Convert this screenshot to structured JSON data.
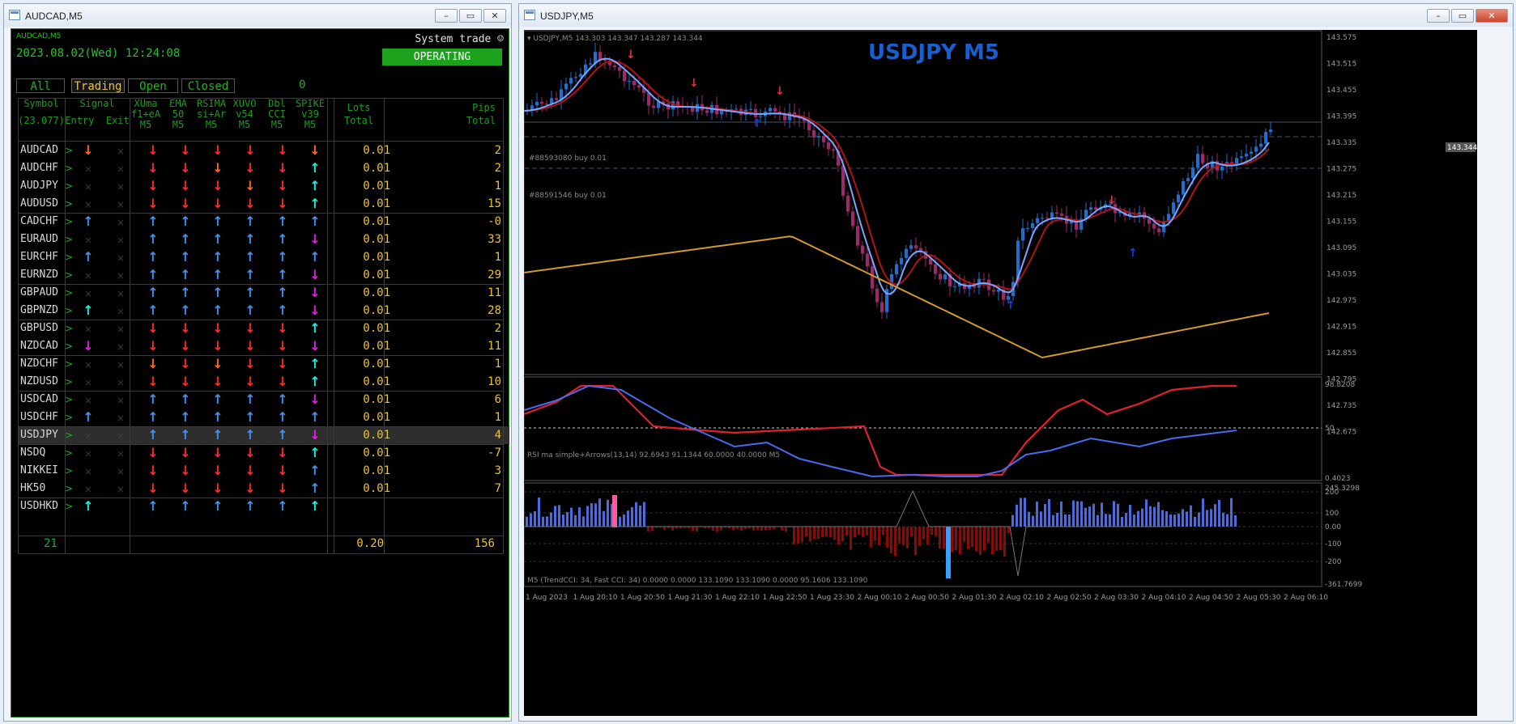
{
  "left_window": {
    "title": "AUDCAD,M5",
    "min_label": "0",
    "max_label": "1",
    "close_label": "r",
    "panel_symbol": "AUDCAD,M5",
    "datetime": "2023.08.02(Wed) 12:24:08",
    "system_trade": "System trade ☺",
    "status": "OPERATING",
    "filters": [
      "All",
      "Trading",
      "Open",
      "Closed"
    ],
    "filter_count": "0",
    "headers": {
      "symbol": [
        "Symbol",
        "(23.077)"
      ],
      "signal": [
        "Signal",
        "Entry  Exit"
      ],
      "xuma": [
        "XUma",
        "f1+eA",
        "M5"
      ],
      "ema": [
        "EMA",
        "50",
        "M5"
      ],
      "rsima": [
        "RSIMA",
        "si+Ar",
        "M5"
      ],
      "xuvo": [
        "XUVO",
        "v54",
        "M5"
      ],
      "dblcci": [
        "Dbl",
        "CCI",
        "M5"
      ],
      "spike": [
        "SPIKE",
        "v39",
        "M5"
      ],
      "lots": [
        "Lots",
        "Total"
      ],
      "pips": [
        "Pips",
        "Total"
      ]
    },
    "colors": {
      "up_blue": "#4a8fe6",
      "up_cyan": "#19f0e0",
      "down_red": "#ff2a2a",
      "down_orange": "#ff6a1a",
      "down_magenta": "#e01ee8",
      "gold": "#e8c23a",
      "green": "#1ca21c"
    },
    "rows": [
      {
        "symbol": "AUDCAD",
        "entry": "down-orange",
        "exit": "x",
        "sig": [
          "down-red",
          "down-red",
          "down-red",
          "down-red",
          "down-red",
          "down-orange"
        ],
        "lots": "0.01",
        "pips": "2"
      },
      {
        "symbol": "AUDCHF",
        "entry": "x",
        "exit": "x",
        "sig": [
          "down-red",
          "down-red",
          "down-orange",
          "down-red",
          "down-red",
          "up-cyan"
        ],
        "lots": "0.01",
        "pips": "2"
      },
      {
        "symbol": "AUDJPY",
        "entry": "x",
        "exit": "x",
        "sig": [
          "down-red",
          "down-red",
          "down-red",
          "down-orange",
          "down-red",
          "up-cyan"
        ],
        "lots": "0.01",
        "pips": "1"
      },
      {
        "symbol": "AUDUSD",
        "entry": "x",
        "exit": "x",
        "sig": [
          "down-red",
          "down-red",
          "down-red",
          "down-red",
          "down-red",
          "up-cyan"
        ],
        "lots": "0.01",
        "pips": "15"
      },
      {
        "symbol": "CADCHF",
        "entry": "up-blue",
        "exit": "x",
        "sig": [
          "up-blue",
          "up-blue",
          "up-blue",
          "up-blue",
          "up-blue",
          "up-blue"
        ],
        "lots": "0.01",
        "pips": "-0"
      },
      {
        "symbol": "EURAUD",
        "entry": "x",
        "exit": "x",
        "sig": [
          "up-blue",
          "up-blue",
          "up-blue",
          "up-blue",
          "up-blue",
          "down-magenta"
        ],
        "lots": "0.01",
        "pips": "33"
      },
      {
        "symbol": "EURCHF",
        "entry": "up-blue",
        "exit": "x",
        "sig": [
          "up-blue",
          "up-blue",
          "up-blue",
          "up-blue",
          "up-blue",
          "up-blue"
        ],
        "lots": "0.01",
        "pips": "1"
      },
      {
        "symbol": "EURNZD",
        "entry": "x",
        "exit": "x",
        "sig": [
          "up-blue",
          "up-blue",
          "up-blue",
          "up-blue",
          "up-blue",
          "down-magenta"
        ],
        "lots": "0.01",
        "pips": "29"
      },
      {
        "symbol": "GBPAUD",
        "entry": "x",
        "exit": "x",
        "sig": [
          "up-blue",
          "up-blue",
          "up-blue",
          "up-blue",
          "up-blue",
          "down-magenta"
        ],
        "lots": "0.01",
        "pips": "11"
      },
      {
        "symbol": "GBPNZD",
        "entry": "up-cyan",
        "exit": "x",
        "sig": [
          "up-blue",
          "up-blue",
          "up-blue",
          "up-blue",
          "up-blue",
          "down-magenta"
        ],
        "lots": "0.01",
        "pips": "28"
      },
      {
        "symbol": "GBPUSD",
        "entry": "x",
        "exit": "x",
        "sig": [
          "down-red",
          "down-red",
          "down-red",
          "down-red",
          "down-red",
          "up-cyan"
        ],
        "lots": "0.01",
        "pips": "2"
      },
      {
        "symbol": "NZDCAD",
        "entry": "down-magenta",
        "exit": "x",
        "sig": [
          "down-red",
          "down-red",
          "down-red",
          "down-red",
          "down-red",
          "down-magenta"
        ],
        "lots": "0.01",
        "pips": "11"
      },
      {
        "symbol": "NZDCHF",
        "entry": "x",
        "exit": "x",
        "sig": [
          "down-orange",
          "down-red",
          "down-orange",
          "down-red",
          "down-red",
          "up-cyan"
        ],
        "lots": "0.01",
        "pips": "1"
      },
      {
        "symbol": "NZDUSD",
        "entry": "x",
        "exit": "x",
        "sig": [
          "down-red",
          "down-red",
          "down-red",
          "down-red",
          "down-red",
          "up-cyan"
        ],
        "lots": "0.01",
        "pips": "10"
      },
      {
        "symbol": "USDCAD",
        "entry": "x",
        "exit": "x",
        "sig": [
          "up-blue",
          "up-blue",
          "up-blue",
          "up-blue",
          "up-blue",
          "down-magenta"
        ],
        "lots": "0.01",
        "pips": "6"
      },
      {
        "symbol": "USDCHF",
        "entry": "up-blue",
        "exit": "x",
        "sig": [
          "up-blue",
          "up-blue",
          "up-blue",
          "up-blue",
          "up-blue",
          "up-blue"
        ],
        "lots": "0.01",
        "pips": "1"
      },
      {
        "symbol": "USDJPY",
        "entry": "x",
        "exit": "x",
        "sig": [
          "up-blue",
          "up-blue",
          "up-blue",
          "up-blue",
          "up-blue",
          "down-magenta"
        ],
        "lots": "0.01",
        "pips": "4",
        "selected": true
      },
      {
        "symbol": "NSDQ",
        "entry": "x",
        "exit": "x",
        "sig": [
          "down-red",
          "down-red",
          "down-red",
          "down-red",
          "down-red",
          "up-cyan"
        ],
        "lots": "0.01",
        "pips": "-7"
      },
      {
        "symbol": "NIKKEI",
        "entry": "x",
        "exit": "x",
        "sig": [
          "down-red",
          "down-red",
          "down-red",
          "down-red",
          "down-red",
          "up-blue"
        ],
        "lots": "0.01",
        "pips": "3"
      },
      {
        "symbol": "HK50",
        "entry": "x",
        "exit": "x",
        "sig": [
          "down-red",
          "down-red",
          "down-red",
          "down-red",
          "down-red",
          "up-blue"
        ],
        "lots": "0.01",
        "pips": "7"
      },
      {
        "symbol": "USDHKD",
        "entry": "up-cyan",
        "exit": "",
        "sig": [
          "up-blue",
          "up-blue",
          "up-blue",
          "up-blue",
          "up-blue",
          "up-cyan"
        ],
        "lots": "",
        "pips": ""
      }
    ],
    "totals": {
      "count": "21",
      "lots": "0.20",
      "pips": "156"
    }
  },
  "right_window": {
    "title": "USDJPY,M5",
    "chart_title": "USDJPY M5",
    "ohlc_header": "▾ USDJPY,M5  143.303 143.347 143.287 143.344",
    "price_badge": "143.344",
    "order1": "#88593080 buy 0.01",
    "order2": "#88591546 buy 0.01",
    "price_ticks": [
      "143.575",
      "143.515",
      "143.455",
      "143.395",
      "143.335",
      "143.275",
      "143.215",
      "143.155",
      "143.095",
      "143.035",
      "142.975",
      "142.915",
      "142.855",
      "142.795",
      "142.735",
      "142.675"
    ],
    "rsi_label": "RSI ma simple+Arrows(13,14) 92.6943 91.1344 60.0000 40.0000  M5",
    "rsi_ticks": [
      "98.8208",
      "50",
      "0.4023"
    ],
    "cci_label": "M5 (TrendCCI: 34, Fast CCI: 34)  0.0000 0.0000 133.1090 133.1090 0.0000 95.1606 133.1090",
    "cci_ticks": [
      "245.3298",
      "200",
      "100",
      "0.00",
      "-100",
      "-200",
      "-361.7699"
    ],
    "time_ticks": [
      "1 Aug 2023",
      "1 Aug 20:10",
      "1 Aug 20:50",
      "1 Aug 21:30",
      "1 Aug 22:10",
      "1 Aug 22:50",
      "1 Aug 23:30",
      "2 Aug 00:10",
      "2 Aug 00:50",
      "2 Aug 01:30",
      "2 Aug 02:10",
      "2 Aug 02:50",
      "2 Aug 03:30",
      "2 Aug 04:10",
      "2 Aug 04:50",
      "2 Aug 05:30",
      "2 Aug 06:10"
    ],
    "colors": {
      "bull": "#1e6fd0",
      "bear": "#a0286a",
      "fast_ma": "#7aa6ff",
      "slow_ma": "#d19a2a",
      "mid_ma": "#b01414",
      "rsi_blue": "#2020c0",
      "rsi_red": "#e0202e",
      "rsi_signal": "#4a6af0"
    }
  }
}
